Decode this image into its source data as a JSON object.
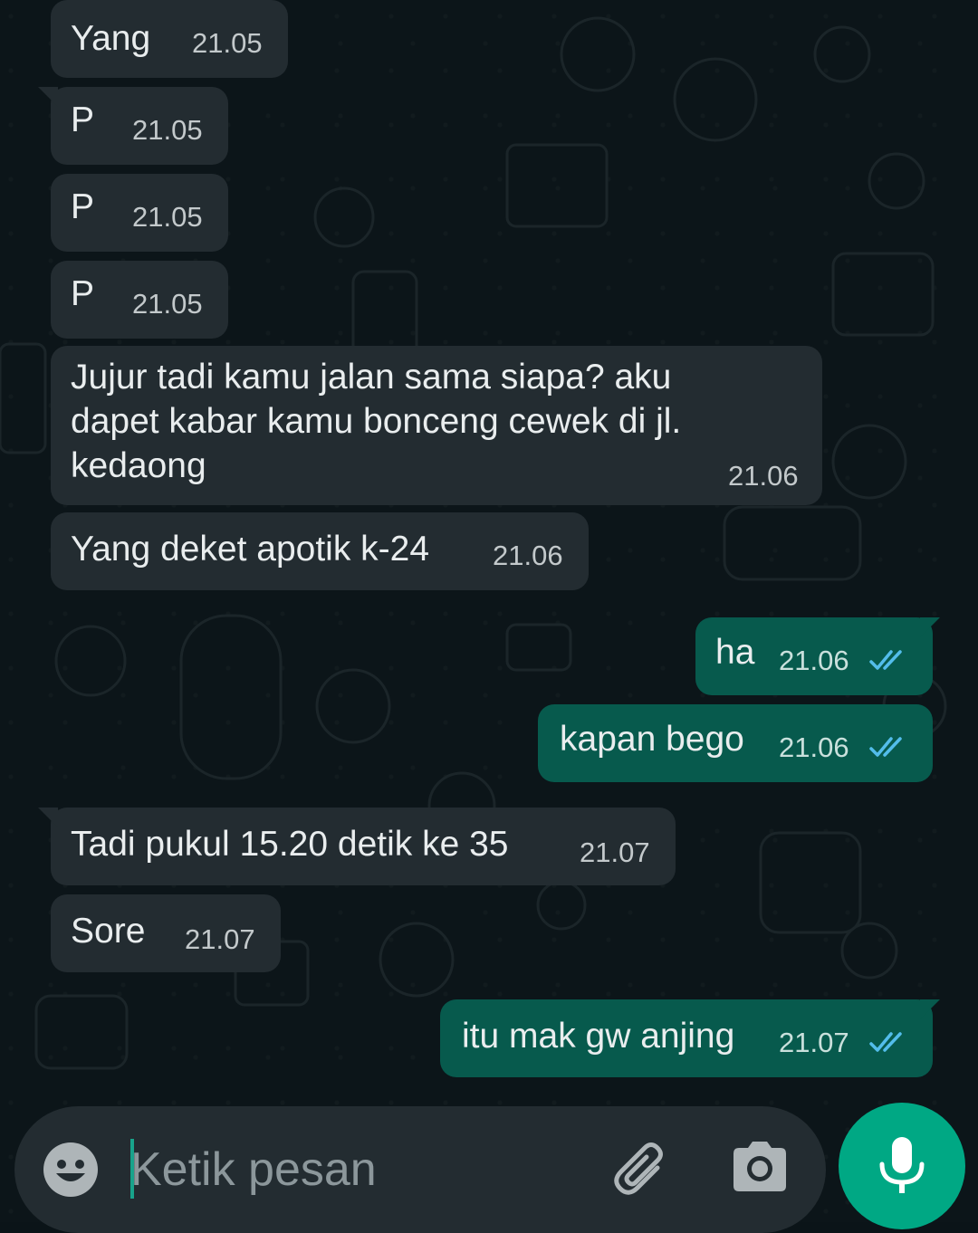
{
  "messages": [
    {
      "dir": "in",
      "text": "Yang",
      "time": "21.05"
    },
    {
      "dir": "in",
      "text": "P",
      "time": "21.05"
    },
    {
      "dir": "in",
      "text": "P",
      "time": "21.05"
    },
    {
      "dir": "in",
      "text": "P",
      "time": "21.05"
    },
    {
      "dir": "in",
      "text": "Jujur tadi kamu jalan sama siapa? aku dapet kabar kamu bonceng cewek di jl. kedaong",
      "time": "21.06"
    },
    {
      "dir": "in",
      "text": "Yang deket apotik k-24",
      "time": "21.06"
    },
    {
      "dir": "out",
      "text": "ha",
      "time": "21.06",
      "status": "read"
    },
    {
      "dir": "out",
      "text": "kapan bego",
      "time": "21.06",
      "status": "read"
    },
    {
      "dir": "in",
      "text": "Tadi pukul 15.20 detik ke 35",
      "time": "21.07"
    },
    {
      "dir": "in",
      "text": "Sore",
      "time": "21.07"
    },
    {
      "dir": "out",
      "text": "itu mak gw anjing",
      "time": "21.07",
      "status": "read"
    }
  ],
  "composer": {
    "placeholder": "Ketik pesan",
    "emoji_icon": "emoji-icon",
    "attach_icon": "paperclip-icon",
    "camera_icon": "camera-icon",
    "mic_icon": "microphone-icon"
  },
  "colors": {
    "incoming_bubble": "#232c31",
    "outgoing_bubble": "#075a4d",
    "read_ticks": "#53bdeb",
    "mic_button": "#00a884",
    "background": "#0c1519"
  }
}
